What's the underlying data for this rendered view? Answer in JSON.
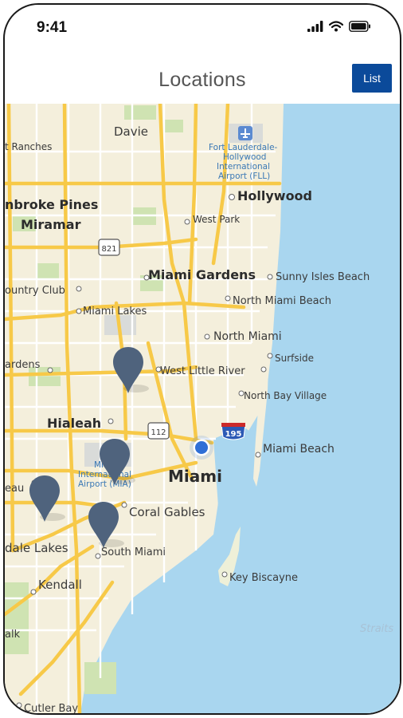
{
  "status_bar": {
    "time": "9:41"
  },
  "header": {
    "title": "Locations",
    "list_button": "List"
  },
  "map": {
    "labels": {
      "davie": "Davie",
      "fort_ranches": "t Ranches",
      "airport_fll_1": "Fort Lauderdale-",
      "airport_fll_2": "Hollywood",
      "airport_fll_3": "International",
      "airport_fll_4": "Airport (FLL)",
      "hollywood": "Hollywood",
      "pembroke_pines": "nbroke Pines",
      "miramar": "Miramar",
      "west_park": "West Park",
      "hwy_821": "821",
      "miami_gardens": "Miami Gardens",
      "sunny_isles": "Sunny Isles Beach",
      "country_club": "ountry Club",
      "miami_lakes": "Miami Lakes",
      "north_miami_beach": "North Miami Beach",
      "north_miami": "North Miami",
      "surfside": "Surfside",
      "gardens": "ardens",
      "west_little_river": "West Little River",
      "north_bay_village": "North Bay Village",
      "hialeah": "Hialeah",
      "hwy_112": "112",
      "hwy_195": "195",
      "miami_beach": "Miami Beach",
      "airport_mia_1": "Miami",
      "airport_mia_2": "International",
      "airport_mia_3": "Airport (MIA)",
      "miami": "Miami",
      "beau": "eau",
      "coral_gables": "Coral Gables",
      "dale_lakes": "dale Lakes",
      "south_miami": "South Miami",
      "key_biscayne": "Key Biscayne",
      "kendall": "Kendall",
      "straits": "Straits",
      "alk": "alk",
      "cutler_bay": "Cutler Bay"
    },
    "pin_count": 4,
    "colors": {
      "land": "#f4efdc",
      "water": "#a9d6ef",
      "highway": "#f7c948",
      "pin": "#4f637d",
      "current_location": "#2f6fd6"
    }
  }
}
